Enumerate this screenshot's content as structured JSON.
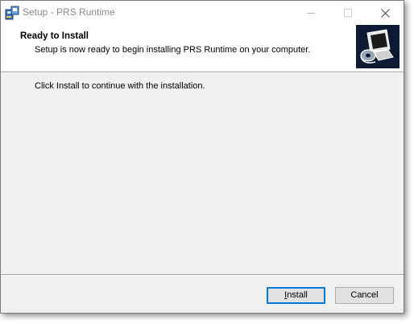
{
  "window": {
    "title": "Setup - PRS Runtime",
    "controls": {
      "minimize": "minimize-icon",
      "maximize": "maximize-icon",
      "close": "close-icon"
    }
  },
  "header": {
    "title": "Ready to Install",
    "subtitle": "Setup is now ready to begin installing PRS Runtime on your computer.",
    "image": "computer-install-icon"
  },
  "body": {
    "text": "Click Install to continue with the installation."
  },
  "buttons": {
    "install_label_mnemonic": "I",
    "install_label_rest": "nstall",
    "cancel_label": "Cancel"
  },
  "colors": {
    "accent": "#0078d7",
    "header_image_bg": "#0c1a33",
    "dialog_bg": "#f0f0f0"
  }
}
